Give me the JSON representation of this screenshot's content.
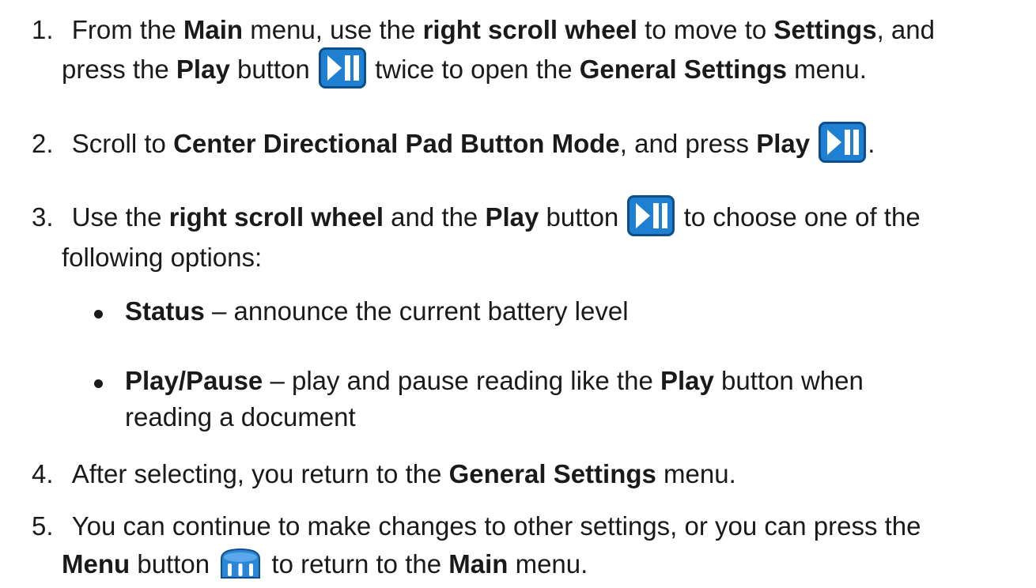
{
  "steps": [
    {
      "number": "1.",
      "line1": {
        "t1": "From the ",
        "b1": "Main",
        "t2": " menu, use the ",
        "b2": "right scroll wheel",
        "t3": " to move to ",
        "b3": "Settings",
        "t4": ", and"
      },
      "line2": {
        "t1": "press the ",
        "b1": "Play",
        "t2": " button ",
        "t3": " twice to open the ",
        "b2": "General Settings",
        "t4": " menu."
      }
    },
    {
      "number": "2.",
      "line1": {
        "t1": "Scroll to ",
        "b1": "Center Directional Pad Button Mode",
        "t2": ", and press ",
        "b2": "Play",
        "t3": "."
      }
    },
    {
      "number": "3.",
      "line1": {
        "t1": "Use the ",
        "b1": "right scroll wheel",
        "t2": " and the ",
        "b2": "Play",
        "t3": " button ",
        "t4": " to choose one of the"
      },
      "line2": {
        "t1": "following options:"
      },
      "options": [
        {
          "label": "Status",
          "text": " – announce the current battery level"
        },
        {
          "label": "Play/Pause",
          "text": " – play and pause reading like the ",
          "bold": "Play",
          "text2": " button when",
          "line2": "reading a document"
        }
      ]
    },
    {
      "number": "4.",
      "line1": {
        "t1": "After selecting, you return to the ",
        "b1": "General Settings",
        "t2": " menu."
      }
    },
    {
      "number": "5.",
      "line1": {
        "t1": "You can continue to make changes to other settings, or you can press the"
      },
      "line2": {
        "b1": "Menu",
        "t1": " button ",
        "t2": " to return to the ",
        "b2": "Main",
        "t3": " menu."
      }
    }
  ],
  "icons": {
    "play": "play-pause-icon",
    "menu": "menu-button-icon",
    "play_color": "#1f7fd1",
    "play_border": "#0d4f8a",
    "menu_color": "#2a86d6"
  }
}
